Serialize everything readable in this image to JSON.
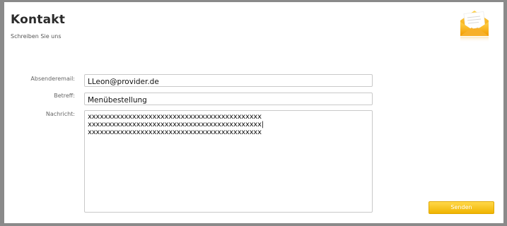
{
  "header": {
    "title": "Kontakt",
    "subtitle": "Schreiben Sie uns",
    "icon": "envelope-icon"
  },
  "form": {
    "email_label": "Absenderemail:",
    "email_value": "LLeon@provider.de",
    "subject_label": "Betreff:",
    "subject_value": "Menübestellung",
    "message_label": "Nachricht:",
    "message_value": "xxxxxxxxxxxxxxxxxxxxxxxxxxxxxxxxxxxxxxxxxxx\nxxxxxxxxxxxxxxxxxxxxxxxxxxxxxxxxxxxxxxxxxxx|\nxxxxxxxxxxxxxxxxxxxxxxxxxxxxxxxxxxxxxxxxxxx",
    "send_label": "Senden"
  },
  "colors": {
    "frame": "#8a8a8a",
    "accent": "#f0b400",
    "title": "#2b2b2b"
  }
}
